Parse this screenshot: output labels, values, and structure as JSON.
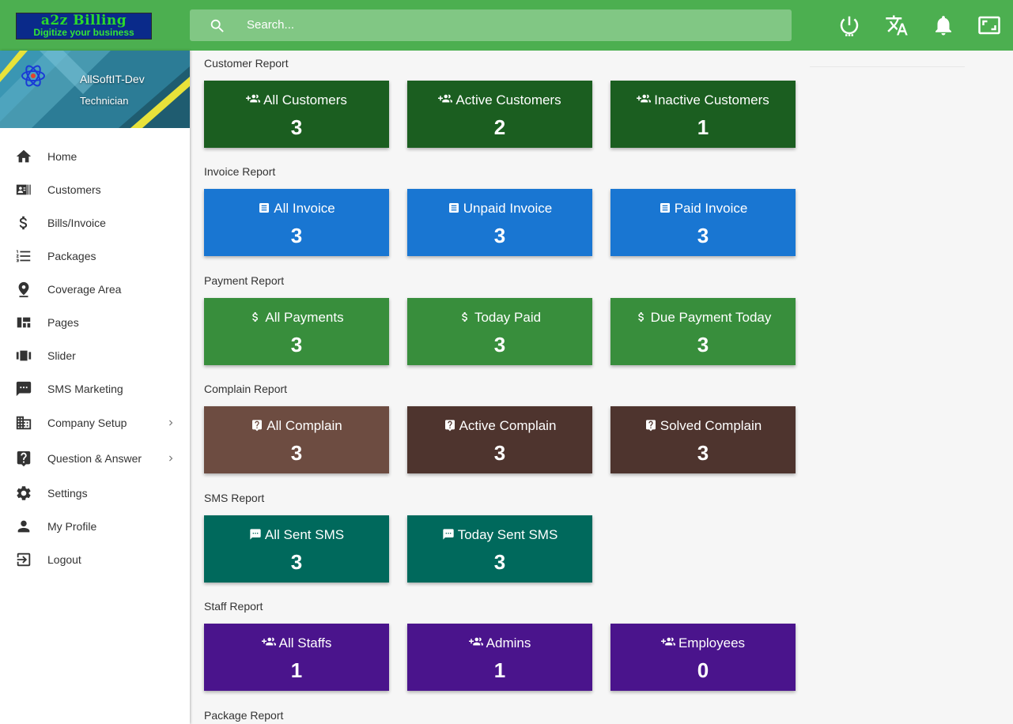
{
  "app": {
    "logo_title": "a2z Billing",
    "logo_tagline": "Digitize your business",
    "search_placeholder": "Search..."
  },
  "topbar_icons": [
    "power-icon",
    "translate-icon",
    "bell-icon",
    "fullscreen-icon"
  ],
  "user": {
    "name": "AllSoftIT-Dev",
    "role": "Technician"
  },
  "sidebar": {
    "items": [
      {
        "label": "Home",
        "icon": "home-icon"
      },
      {
        "label": "Customers",
        "icon": "contacts-icon"
      },
      {
        "label": "Bills/Invoice",
        "icon": "dollar-icon"
      },
      {
        "label": "Packages",
        "icon": "list-icon"
      },
      {
        "label": "Coverage Area",
        "icon": "location-pin-icon"
      },
      {
        "label": "Pages",
        "icon": "dashboard-icon"
      },
      {
        "label": "Slider",
        "icon": "carousel-icon"
      },
      {
        "label": "SMS Marketing",
        "icon": "sms-icon"
      },
      {
        "label": "Company Setup",
        "icon": "building-icon"
      },
      {
        "label": "Question & Answer",
        "icon": "question-icon"
      },
      {
        "label": "Settings",
        "icon": "gear-icon"
      },
      {
        "label": "My Profile",
        "icon": "person-icon"
      },
      {
        "label": "Logout",
        "icon": "logout-icon"
      }
    ]
  },
  "reports": {
    "customer": {
      "title": "Customer Report",
      "cards": [
        {
          "label": "All Customers",
          "value": "3"
        },
        {
          "label": "Active Customers",
          "value": "2"
        },
        {
          "label": "Inactive Customers",
          "value": "1"
        }
      ]
    },
    "invoice": {
      "title": "Invoice Report",
      "cards": [
        {
          "label": "All Invoice",
          "value": "3"
        },
        {
          "label": "Unpaid Invoice",
          "value": "3"
        },
        {
          "label": "Paid Invoice",
          "value": "3"
        }
      ]
    },
    "payment": {
      "title": "Payment Report",
      "cards": [
        {
          "label": "All Payments",
          "value": "3"
        },
        {
          "label": "Today Paid",
          "value": "3"
        },
        {
          "label": "Due Payment Today",
          "value": "3"
        }
      ]
    },
    "complain": {
      "title": "Complain Report",
      "cards": [
        {
          "label": "All Complain",
          "value": "3"
        },
        {
          "label": "Active Complain",
          "value": "3"
        },
        {
          "label": "Solved Complain",
          "value": "3"
        }
      ]
    },
    "sms": {
      "title": "SMS Report",
      "cards": [
        {
          "label": "All Sent SMS",
          "value": "3"
        },
        {
          "label": "Today Sent SMS",
          "value": "3"
        }
      ]
    },
    "staff": {
      "title": "Staff Report",
      "cards": [
        {
          "label": "All Staffs",
          "value": "1"
        },
        {
          "label": "Admins",
          "value": "1"
        },
        {
          "label": "Employees",
          "value": "0"
        }
      ]
    },
    "package": {
      "title": "Package Report"
    }
  },
  "colors": {
    "topbar": "#4caf50",
    "search": "#81c784",
    "customer_card": "#1b5e20",
    "invoice_card": "#1976d2",
    "payment_card": "#388e3c",
    "complain_all_card": "#6d4c41",
    "complain_card": "#4e342e",
    "sms_card": "#00695c",
    "staff_card": "#4a148c"
  }
}
